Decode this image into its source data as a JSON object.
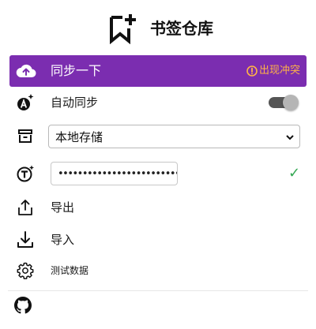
{
  "header": {
    "title": "书签仓库",
    "logo_icon": "bookmark-plus-icon"
  },
  "sync_bar": {
    "label": "同步一下",
    "conflict_label": "出现冲突",
    "icon": "cloud-upload-icon",
    "alert_icon": "alert-circle-icon",
    "background_color": "#7b2db0",
    "conflict_color": "#ffb347"
  },
  "auto_sync": {
    "label": "自动同步",
    "icon": "auto-sync-icon",
    "toggle_on": true
  },
  "storage": {
    "icon": "archive-icon",
    "selected": "本地存储"
  },
  "token": {
    "icon": "text-token-icon",
    "masked_value": "••••••••••••••••••••••••••••••••••••",
    "valid_mark": "✓",
    "valid_color": "#34a853"
  },
  "menu": {
    "export_label": "导出",
    "export_icon": "upload-icon",
    "import_label": "导入",
    "import_icon": "download-icon",
    "test_label": "测试数据",
    "test_icon": "gear-icon"
  },
  "footer": {
    "github_icon": "github-icon"
  }
}
